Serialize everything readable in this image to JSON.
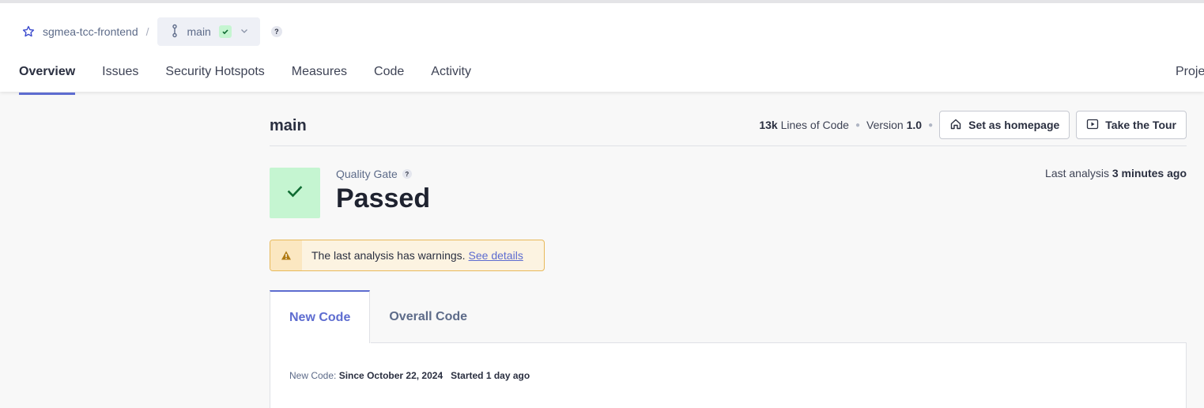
{
  "breadcrumb": {
    "project": "sgmea-tcc-frontend",
    "separator": "/",
    "branch": "main",
    "help": "?"
  },
  "nav": {
    "tabs": [
      "Overview",
      "Issues",
      "Security Hotspots",
      "Measures",
      "Code",
      "Activity"
    ],
    "active": "Overview",
    "right_item": "Proje"
  },
  "header": {
    "branch_title": "main",
    "loc_value": "13k",
    "loc_label": "Lines of Code",
    "version_label": "Version",
    "version_value": "1.0",
    "set_homepage": "Set as homepage",
    "take_tour": "Take the Tour"
  },
  "quality_gate": {
    "label": "Quality Gate",
    "help": "?",
    "status": "Passed",
    "last_analysis_label": "Last analysis",
    "last_analysis_value": "3 minutes ago"
  },
  "warning": {
    "text": "The last analysis has warnings.",
    "link": "See details"
  },
  "code_tabs": {
    "new_code": "New Code",
    "overall_code": "Overall Code",
    "new_code_label": "New Code:",
    "since": "Since October 22, 2024",
    "started": "Started 1 day ago"
  },
  "colors": {
    "accent": "#5d6cd0",
    "passed_bg": "#c5f5d1",
    "passed_fg": "#0f6b32",
    "warning_bg": "#fcf3e1",
    "warning_border": "#e8b95a"
  }
}
